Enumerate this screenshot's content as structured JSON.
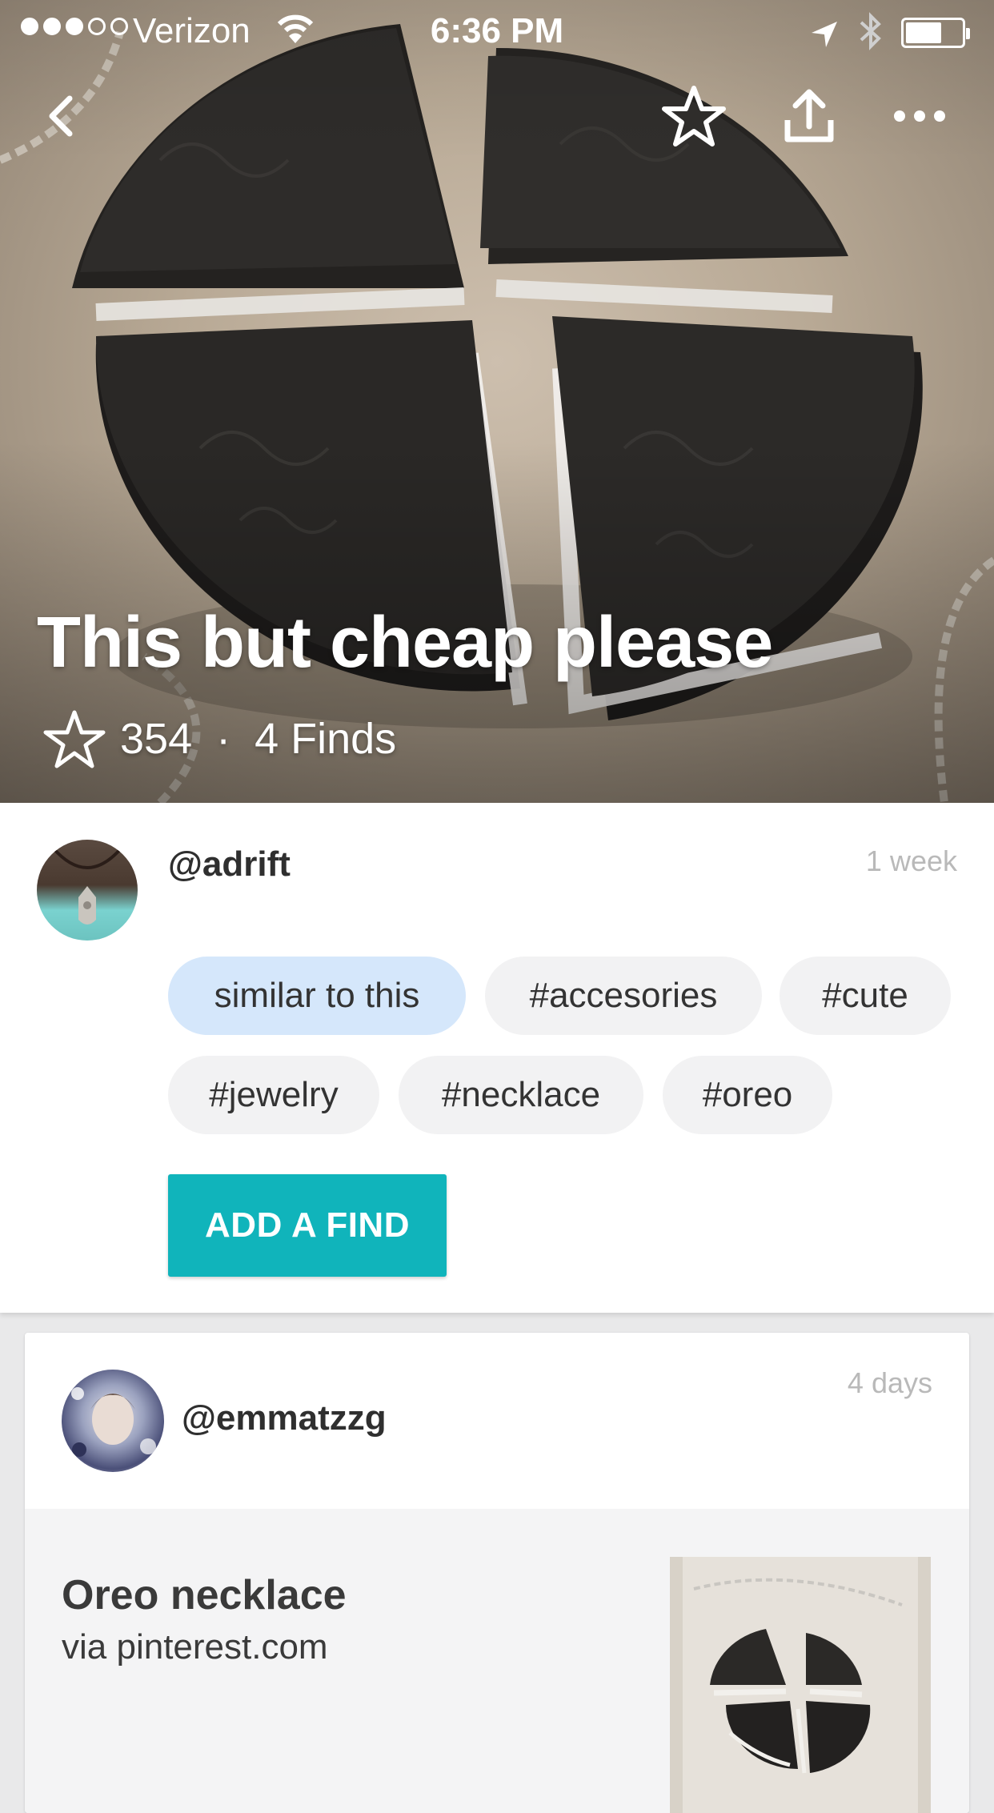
{
  "status_bar": {
    "carrier": "Verizon",
    "time": "6:36 PM",
    "signal_dots_filled": 3,
    "signal_dots_total": 5,
    "battery_level": 0.6
  },
  "nav": {
    "back_icon": "chevron-left-icon",
    "favorite_icon": "star-outline-icon",
    "share_icon": "share-icon",
    "more_icon": "more-dots-icon"
  },
  "hero": {
    "title": "This but cheap please",
    "star_count": "354",
    "separator": "·",
    "finds": "4 Finds"
  },
  "post": {
    "username": "@adrift",
    "time": "1 week",
    "tags": [
      "similar to this",
      "#accesories",
      "#cute",
      "#jewelry",
      "#necklace",
      "#oreo"
    ],
    "add_find_label": "ADD A FIND"
  },
  "find": {
    "username": "@emmatzzg",
    "time": "4 days",
    "title": "Oreo necklace",
    "source": "via pinterest.com"
  },
  "colors": {
    "accent": "#10b4bb",
    "tag_primary": "#d5e7fb",
    "tag_default": "#f2f2f3"
  }
}
